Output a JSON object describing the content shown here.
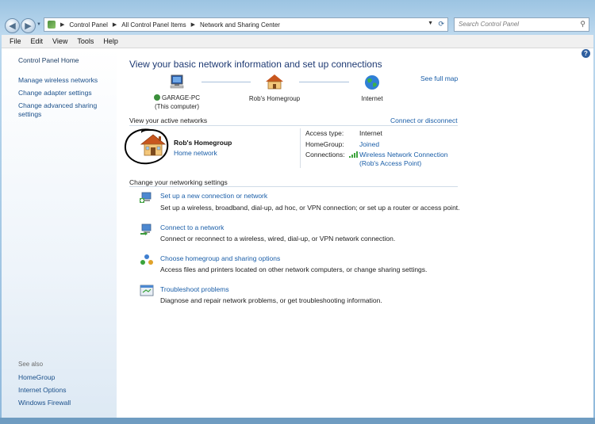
{
  "address": {
    "segments": [
      "Control Panel",
      "All Control Panel Items",
      "Network and Sharing Center"
    ]
  },
  "search": {
    "placeholder": "Search Control Panel"
  },
  "menu": [
    "File",
    "Edit",
    "View",
    "Tools",
    "Help"
  ],
  "sidebar": {
    "home": "Control Panel Home",
    "items": [
      "Manage wireless networks",
      "Change adapter settings",
      "Change advanced sharing settings"
    ],
    "see_also_title": "See also",
    "see_also": [
      "HomeGroup",
      "Internet Options",
      "Windows Firewall"
    ]
  },
  "main": {
    "heading": "View your basic network information and set up connections",
    "see_full_map": "See full map",
    "map": {
      "computer_name": "GARAGE-PC",
      "computer_sub": "(This computer)",
      "homegroup": "Rob's Homegroup",
      "internet": "Internet"
    },
    "active_networks_title": "View your active networks",
    "connect_disconnect": "Connect or disconnect",
    "network": {
      "name": "Rob's Homegroup",
      "type": "Home network",
      "access_type_label": "Access type:",
      "access_type_value": "Internet",
      "homegroup_label": "HomeGroup:",
      "homegroup_value": "Joined",
      "connections_label": "Connections:",
      "connection_name": "Wireless Network Connection",
      "connection_ssid": "(Rob's Access Point)"
    },
    "change_settings_title": "Change your networking settings",
    "settings": [
      {
        "title": "Set up a new connection or network",
        "desc": "Set up a wireless, broadband, dial-up, ad hoc, or VPN connection; or set up a router or access point."
      },
      {
        "title": "Connect to a network",
        "desc": "Connect or reconnect to a wireless, wired, dial-up, or VPN network connection."
      },
      {
        "title": "Choose homegroup and sharing options",
        "desc": "Access files and printers located on other network computers, or change sharing settings."
      },
      {
        "title": "Troubleshoot problems",
        "desc": "Diagnose and repair network problems, or get troubleshooting information."
      }
    ]
  },
  "colors": {
    "link": "#1a5ea8",
    "heading": "#1e3a73"
  }
}
